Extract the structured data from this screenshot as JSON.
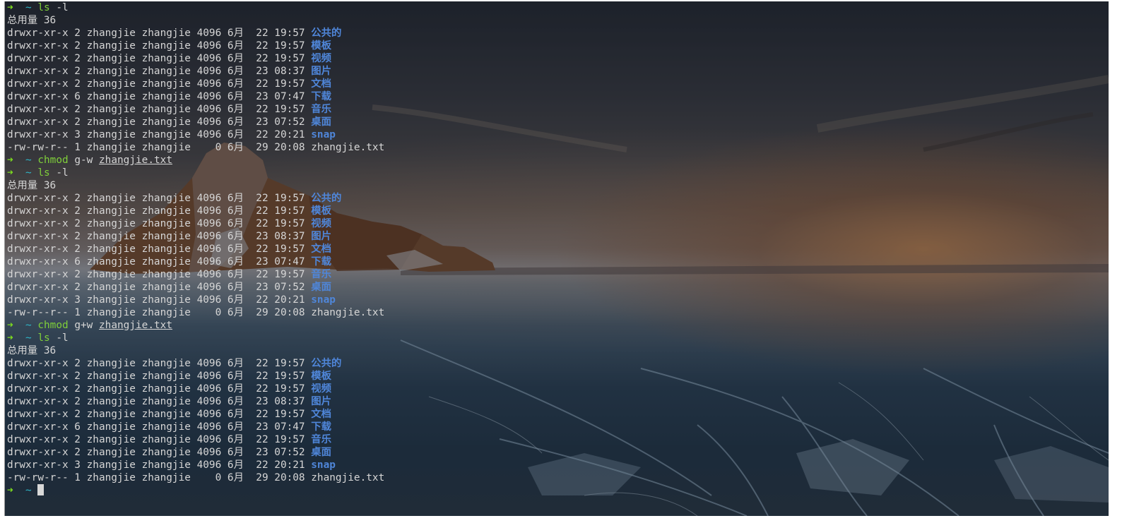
{
  "terminal": {
    "prompt_arrow": "➜",
    "prompt_dir": "~",
    "blocks": [
      {
        "command": {
          "name": "ls",
          "args": "-l",
          "file": ""
        },
        "total": "总用量 36",
        "entries": [
          {
            "meta": "drwxr-xr-x 2 zhangjie zhangjie 4096 6月  22 19:57 ",
            "name": "公共的",
            "kind": "dir"
          },
          {
            "meta": "drwxr-xr-x 2 zhangjie zhangjie 4096 6月  22 19:57 ",
            "name": "模板",
            "kind": "dir"
          },
          {
            "meta": "drwxr-xr-x 2 zhangjie zhangjie 4096 6月  22 19:57 ",
            "name": "视频",
            "kind": "dir"
          },
          {
            "meta": "drwxr-xr-x 2 zhangjie zhangjie 4096 6月  23 08:37 ",
            "name": "图片",
            "kind": "dir"
          },
          {
            "meta": "drwxr-xr-x 2 zhangjie zhangjie 4096 6月  22 19:57 ",
            "name": "文档",
            "kind": "dir"
          },
          {
            "meta": "drwxr-xr-x 6 zhangjie zhangjie 4096 6月  23 07:47 ",
            "name": "下载",
            "kind": "dir"
          },
          {
            "meta": "drwxr-xr-x 2 zhangjie zhangjie 4096 6月  22 19:57 ",
            "name": "音乐",
            "kind": "dir"
          },
          {
            "meta": "drwxr-xr-x 2 zhangjie zhangjie 4096 6月  23 07:52 ",
            "name": "桌面",
            "kind": "dir"
          },
          {
            "meta": "drwxr-xr-x 3 zhangjie zhangjie 4096 6月  22 20:21 ",
            "name": "snap",
            "kind": "dir"
          },
          {
            "meta": "-rw-rw-r-- 1 zhangjie zhangjie    0 6月  29 20:08 ",
            "name": "zhangjie.txt",
            "kind": "file"
          }
        ]
      },
      {
        "command": {
          "name": "chmod",
          "args": "g-w",
          "file": "zhangjie.txt"
        }
      },
      {
        "command": {
          "name": "ls",
          "args": "-l",
          "file": ""
        },
        "total": "总用量 36",
        "entries": [
          {
            "meta": "drwxr-xr-x 2 zhangjie zhangjie 4096 6月  22 19:57 ",
            "name": "公共的",
            "kind": "dir"
          },
          {
            "meta": "drwxr-xr-x 2 zhangjie zhangjie 4096 6月  22 19:57 ",
            "name": "模板",
            "kind": "dir"
          },
          {
            "meta": "drwxr-xr-x 2 zhangjie zhangjie 4096 6月  22 19:57 ",
            "name": "视频",
            "kind": "dir"
          },
          {
            "meta": "drwxr-xr-x 2 zhangjie zhangjie 4096 6月  23 08:37 ",
            "name": "图片",
            "kind": "dir"
          },
          {
            "meta": "drwxr-xr-x 2 zhangjie zhangjie 4096 6月  22 19:57 ",
            "name": "文档",
            "kind": "dir"
          },
          {
            "meta": "drwxr-xr-x 6 zhangjie zhangjie 4096 6月  23 07:47 ",
            "name": "下载",
            "kind": "dir"
          },
          {
            "meta": "drwxr-xr-x 2 zhangjie zhangjie 4096 6月  22 19:57 ",
            "name": "音乐",
            "kind": "dir"
          },
          {
            "meta": "drwxr-xr-x 2 zhangjie zhangjie 4096 6月  23 07:52 ",
            "name": "桌面",
            "kind": "dir"
          },
          {
            "meta": "drwxr-xr-x 3 zhangjie zhangjie 4096 6月  22 20:21 ",
            "name": "snap",
            "kind": "dir"
          },
          {
            "meta": "-rw-r--r-- 1 zhangjie zhangjie    0 6月  29 20:08 ",
            "name": "zhangjie.txt",
            "kind": "file"
          }
        ]
      },
      {
        "command": {
          "name": "chmod",
          "args": "g+w",
          "file": "zhangjie.txt"
        }
      },
      {
        "command": {
          "name": "ls",
          "args": "-l",
          "file": ""
        },
        "total": "总用量 36",
        "entries": [
          {
            "meta": "drwxr-xr-x 2 zhangjie zhangjie 4096 6月  22 19:57 ",
            "name": "公共的",
            "kind": "dir"
          },
          {
            "meta": "drwxr-xr-x 2 zhangjie zhangjie 4096 6月  22 19:57 ",
            "name": "模板",
            "kind": "dir"
          },
          {
            "meta": "drwxr-xr-x 2 zhangjie zhangjie 4096 6月  22 19:57 ",
            "name": "视频",
            "kind": "dir"
          },
          {
            "meta": "drwxr-xr-x 2 zhangjie zhangjie 4096 6月  23 08:37 ",
            "name": "图片",
            "kind": "dir"
          },
          {
            "meta": "drwxr-xr-x 2 zhangjie zhangjie 4096 6月  22 19:57 ",
            "name": "文档",
            "kind": "dir"
          },
          {
            "meta": "drwxr-xr-x 6 zhangjie zhangjie 4096 6月  23 07:47 ",
            "name": "下载",
            "kind": "dir"
          },
          {
            "meta": "drwxr-xr-x 2 zhangjie zhangjie 4096 6月  22 19:57 ",
            "name": "音乐",
            "kind": "dir"
          },
          {
            "meta": "drwxr-xr-x 2 zhangjie zhangjie 4096 6月  23 07:52 ",
            "name": "桌面",
            "kind": "dir"
          },
          {
            "meta": "drwxr-xr-x 3 zhangjie zhangjie 4096 6月  22 20:21 ",
            "name": "snap",
            "kind": "dir"
          },
          {
            "meta": "-rw-rw-r-- 1 zhangjie zhangjie    0 6月  29 20:08 ",
            "name": "zhangjie.txt",
            "kind": "file"
          }
        ]
      }
    ]
  },
  "colors": {
    "prompt_arrow": "#7ddc1f",
    "prompt_dir": "#2fb7c8",
    "command": "#7fcf3a",
    "directory": "#4f86d9",
    "text": "#d6d6d6"
  },
  "icons": {
    "prompt": "arrow-right-icon",
    "cursor": "block-cursor-icon"
  }
}
